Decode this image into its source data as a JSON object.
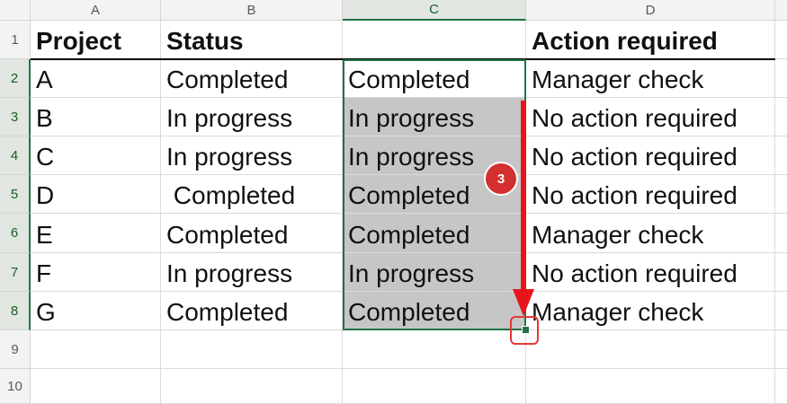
{
  "columns": [
    "A",
    "B",
    "C",
    "D"
  ],
  "rows": [
    "1",
    "2",
    "3",
    "4",
    "5",
    "6",
    "7",
    "8",
    "9",
    "10"
  ],
  "header": {
    "a": "Project",
    "b": "Status",
    "c": "",
    "d": "Action required"
  },
  "data_rows": [
    {
      "a": "A",
      "b": "Completed",
      "c": "Completed",
      "d": "Manager check"
    },
    {
      "a": "B",
      "b": "In progress",
      "c": "In progress",
      "d": "No action required"
    },
    {
      "a": "C",
      "b": "In progress",
      "c": "In progress",
      "d": "No action required"
    },
    {
      "a": "D",
      "b": " Completed",
      "c": "Completed",
      "d": "No action required"
    },
    {
      "a": "E",
      "b": "Completed",
      "c": "Completed",
      "d": "Manager check"
    },
    {
      "a": "F",
      "b": "In progress",
      "c": "In progress",
      "d": "No action required"
    },
    {
      "a": "G",
      "b": "Completed",
      "c": "Completed",
      "d": "Manager check"
    }
  ],
  "annotation": {
    "step_number": "3",
    "arrow_icon": "down-arrow-icon",
    "highlight_icon": "fill-handle-icon"
  },
  "colors": {
    "selection": "#217346",
    "shaded_cells": "#c6c6c6",
    "annotation": "#e8141b"
  }
}
